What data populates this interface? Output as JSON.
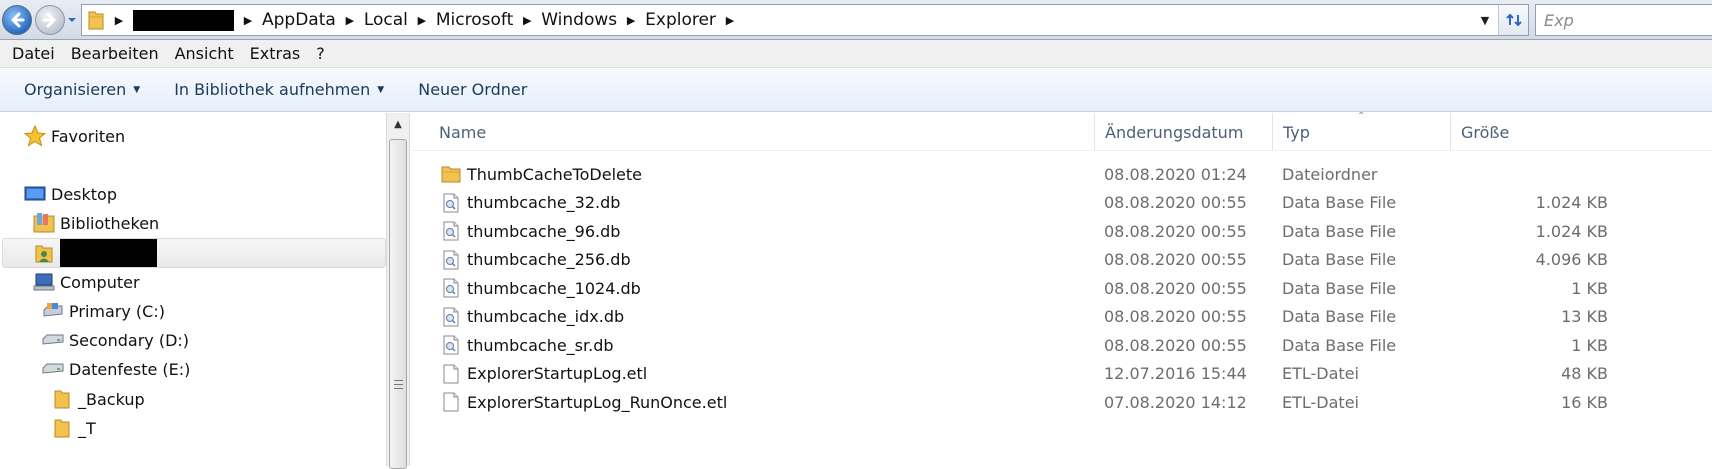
{
  "address_bar": {
    "breadcrumbs": [
      "AppData",
      "Local",
      "Microsoft",
      "Windows",
      "Explorer"
    ],
    "search_placeholder": "Exp"
  },
  "menu": [
    "Datei",
    "Bearbeiten",
    "Ansicht",
    "Extras",
    "?"
  ],
  "commands": {
    "organize": "Organisieren",
    "include_library": "In Bibliothek aufnehmen",
    "new_folder": "Neuer Ordner"
  },
  "navigation": {
    "favorites": "Favoriten",
    "desktop": "Desktop",
    "libraries": "Bibliotheken",
    "computer": "Computer",
    "drives": [
      {
        "label": "Primary (C:)",
        "icon": "system-drive-icon"
      },
      {
        "label": "Secondary (D:)",
        "icon": "drive-icon"
      },
      {
        "label": "Datenfeste (E:)",
        "icon": "drive-icon"
      }
    ],
    "folders": [
      "_Backup",
      "_T"
    ]
  },
  "columns": {
    "name": "Name",
    "date": "Änderungsdatum",
    "type": "Typ",
    "size": "Größe"
  },
  "files": [
    {
      "name": "ThumbCacheToDelete",
      "date": "08.08.2020 01:24",
      "type": "Dateiordner",
      "size": "",
      "icon": "folder-icon"
    },
    {
      "name": "thumbcache_32.db",
      "date": "08.08.2020 00:55",
      "type": "Data Base File",
      "size": "1.024 KB",
      "icon": "db-file-icon"
    },
    {
      "name": "thumbcache_96.db",
      "date": "08.08.2020 00:55",
      "type": "Data Base File",
      "size": "1.024 KB",
      "icon": "db-file-icon"
    },
    {
      "name": "thumbcache_256.db",
      "date": "08.08.2020 00:55",
      "type": "Data Base File",
      "size": "4.096 KB",
      "icon": "db-file-icon"
    },
    {
      "name": "thumbcache_1024.db",
      "date": "08.08.2020 00:55",
      "type": "Data Base File",
      "size": "1 KB",
      "icon": "db-file-icon"
    },
    {
      "name": "thumbcache_idx.db",
      "date": "08.08.2020 00:55",
      "type": "Data Base File",
      "size": "13 KB",
      "icon": "db-file-icon"
    },
    {
      "name": "thumbcache_sr.db",
      "date": "08.08.2020 00:55",
      "type": "Data Base File",
      "size": "1 KB",
      "icon": "db-file-icon"
    },
    {
      "name": "ExplorerStartupLog.etl",
      "date": "12.07.2016 15:44",
      "type": "ETL-Datei",
      "size": "48 KB",
      "icon": "file-icon"
    },
    {
      "name": "ExplorerStartupLog_RunOnce.etl",
      "date": "07.08.2020 14:12",
      "type": "ETL-Datei",
      "size": "16 KB",
      "icon": "file-icon"
    }
  ],
  "colors": {
    "accent": "#2a6bc4",
    "command_text": "#1e395b",
    "header_text": "#4c607a",
    "folder": "#f2c14e"
  }
}
